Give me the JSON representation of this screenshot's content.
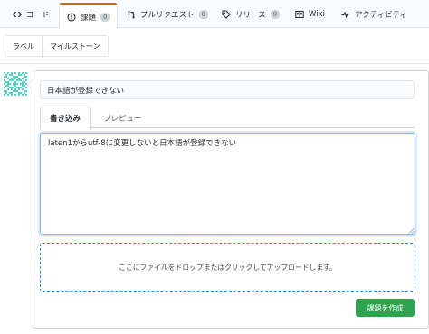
{
  "repo_tabs": [
    {
      "label": "コード",
      "icon": "code-icon"
    },
    {
      "label": "課題",
      "icon": "issue-icon",
      "count": "0"
    },
    {
      "label": "プルリクエスト",
      "icon": "pull-request-icon",
      "count": "0"
    },
    {
      "label": "リリース",
      "icon": "tag-icon",
      "count": "0"
    },
    {
      "label": "Wiki",
      "icon": "book-icon"
    },
    {
      "label": "アクティビティ",
      "icon": "pulse-icon"
    }
  ],
  "subnav": {
    "labels": "ラベル",
    "milestones": "マイルストーン"
  },
  "issue_form": {
    "title_value": "日本語が登録できない",
    "write_tab": "書き込み",
    "preview_tab": "プレビュー",
    "body_value": "laten1からutf-8に変更しないと日本語が登録できない",
    "dropzone_text": "ここにファイルをドロップまたはクリックしてアップロードします。",
    "submit_label": "課題を作成"
  },
  "colors": {
    "active_tab_accent": "#e36209",
    "submit_green": "#2ea44f",
    "dropzone_border": "#2188ff",
    "avatar_identicon": "#4fd1c5"
  }
}
